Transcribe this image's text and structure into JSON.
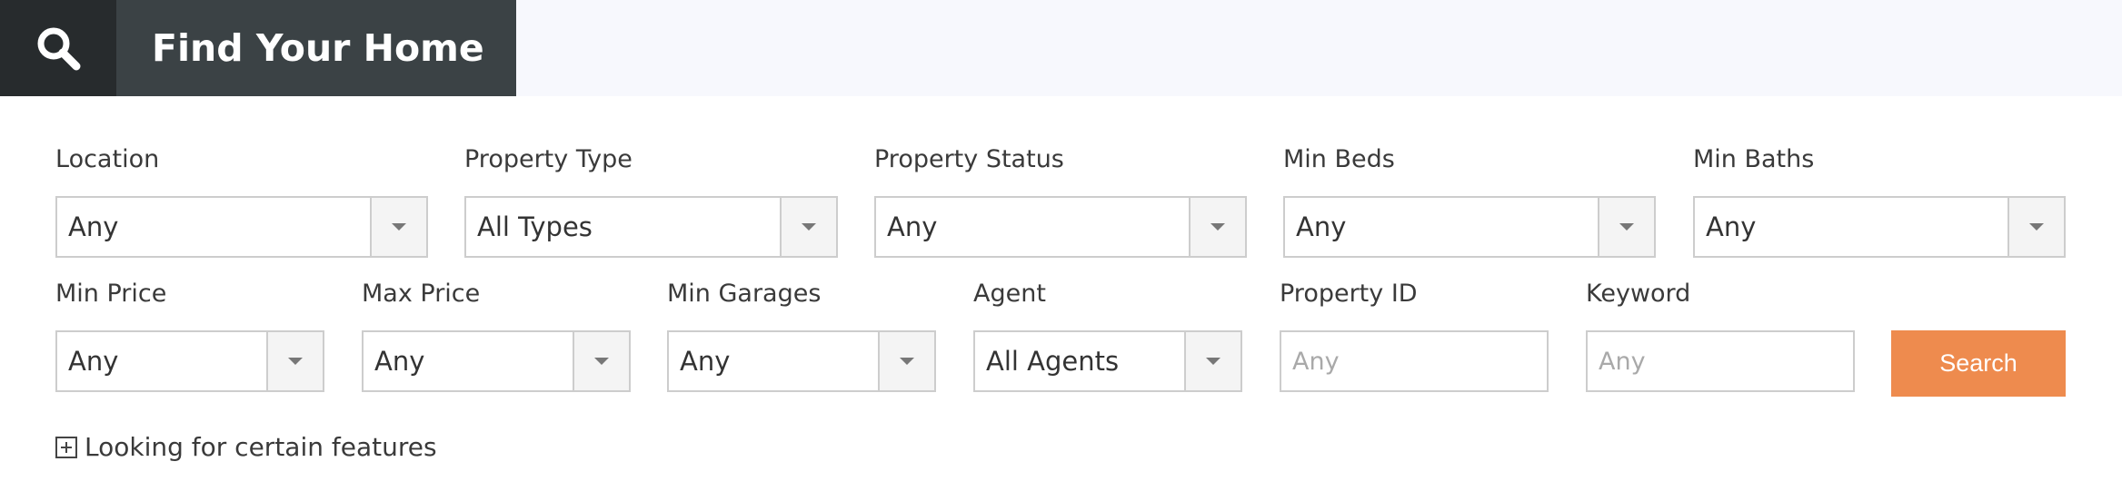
{
  "header": {
    "title": "Find Your Home",
    "icon": "search-icon"
  },
  "row1": [
    {
      "id": "location",
      "label": "Location",
      "value": "Any"
    },
    {
      "id": "property-type",
      "label": "Property Type",
      "value": "All Types"
    },
    {
      "id": "property-status",
      "label": "Property Status",
      "value": "Any"
    },
    {
      "id": "min-beds",
      "label": "Min Beds",
      "value": "Any"
    },
    {
      "id": "min-baths",
      "label": "Min Baths",
      "value": "Any"
    }
  ],
  "row2": [
    {
      "id": "min-price",
      "label": "Min Price",
      "value": "Any"
    },
    {
      "id": "max-price",
      "label": "Max Price",
      "value": "Any"
    },
    {
      "id": "min-garages",
      "label": "Min Garages",
      "value": "Any"
    },
    {
      "id": "agent",
      "label": "Agent",
      "value": "All Agents"
    }
  ],
  "property_id": {
    "label": "Property ID",
    "placeholder": "Any"
  },
  "keyword": {
    "label": "Keyword",
    "placeholder": "Any"
  },
  "search_button": "Search",
  "features_toggle": "Looking for certain features",
  "colors": {
    "accent": "#ee8b4e",
    "header_dark": "#272b2d",
    "header_title_bg": "#3b4245"
  }
}
